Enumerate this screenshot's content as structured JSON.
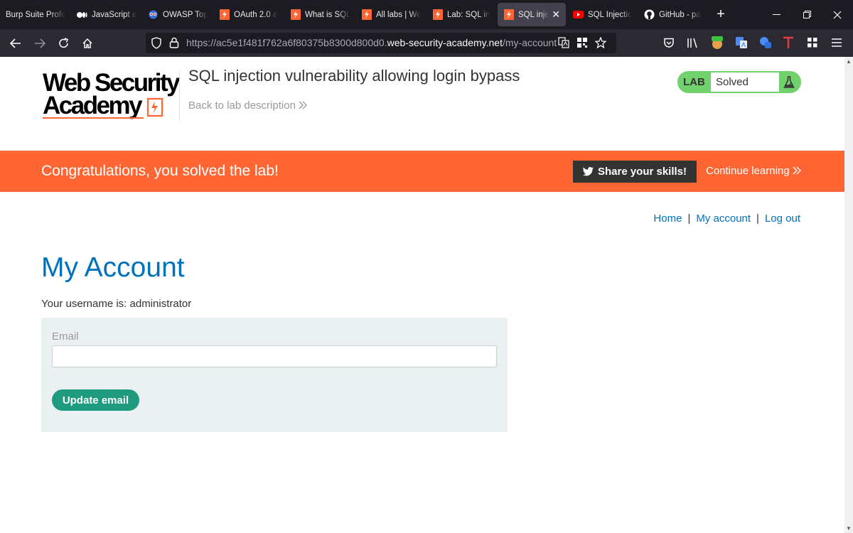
{
  "browser": {
    "tabs": [
      {
        "title": "Burp Suite Profe",
        "icon": "none",
        "active": false
      },
      {
        "title": "JavaScript a",
        "icon": "medium-icon",
        "active": false
      },
      {
        "title": "OWASP Top",
        "icon": "owasp-icon",
        "active": false
      },
      {
        "title": "OAuth 2.0 a",
        "icon": "portswigger-icon",
        "active": false
      },
      {
        "title": "What is SQL",
        "icon": "portswigger-icon",
        "active": false
      },
      {
        "title": "All labs | We",
        "icon": "portswigger-icon",
        "active": false
      },
      {
        "title": "Lab: SQL inj",
        "icon": "portswigger-icon",
        "active": false
      },
      {
        "title": "SQL injec",
        "icon": "portswigger-icon",
        "active": true
      },
      {
        "title": "SQL Injectio",
        "icon": "youtube-icon",
        "active": false
      },
      {
        "title": "GitHub - pa",
        "icon": "github-icon",
        "active": false
      }
    ],
    "url_prefix": "https://ac5e1f481f762a6f80375b8300d800d0.",
    "url_host": "web-security-academy.net",
    "url_path": "/my-account"
  },
  "header": {
    "logo_line1": "Web Security",
    "logo_line2": "Academy",
    "lab_title": "SQL injection vulnerability allowing login bypass",
    "back_link": "Back to lab description",
    "lab_label": "LAB",
    "lab_status": "Solved"
  },
  "banner": {
    "message": "Congratulations, you solved the lab!",
    "share_label": "Share your skills!",
    "continue_label": "Continue learning"
  },
  "nav": {
    "home": "Home",
    "account": "My account",
    "logout": "Log out",
    "separator": "|"
  },
  "main": {
    "heading": "My Account",
    "username_text": "Your username is: administrator",
    "email_label": "Email",
    "email_value": "",
    "update_button": "Update email"
  },
  "colors": {
    "brand_orange": "#ff6633",
    "link_blue": "#0071bc",
    "solved_green": "#70d16d",
    "button_teal": "#1e9b7f"
  }
}
